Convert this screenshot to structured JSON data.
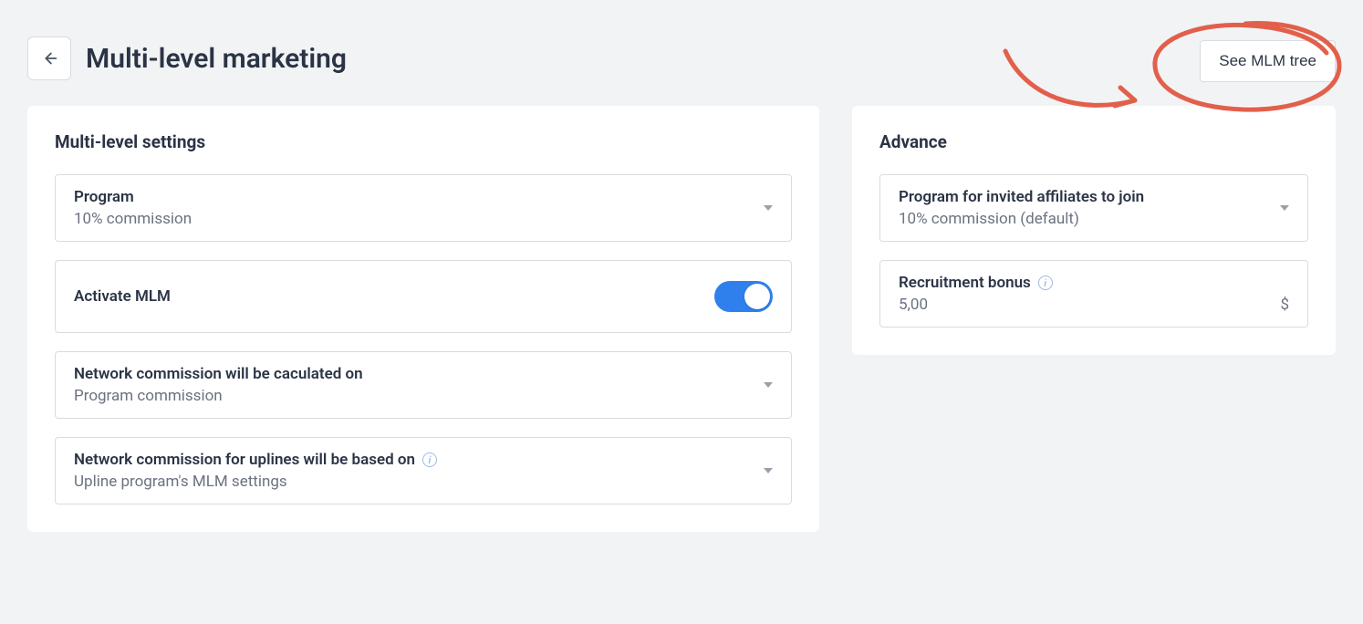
{
  "header": {
    "title": "Multi-level marketing",
    "see_tree_label": "See MLM tree"
  },
  "settings_card": {
    "title": "Multi-level settings",
    "program_label": "Program",
    "program_value": "10% commission",
    "activate_label": "Activate MLM",
    "activate_on": true,
    "network_calc_label": "Network commission will be caculated on",
    "network_calc_value": "Program commission",
    "uplines_label": "Network commission for uplines will be based on",
    "uplines_value": "Upline program's MLM settings"
  },
  "advance_card": {
    "title": "Advance",
    "invited_program_label": "Program for invited affiliates to join",
    "invited_program_value": "10% commission (default)",
    "recruitment_label": "Recruitment bonus",
    "recruitment_value": "5,00",
    "recruitment_currency": "$"
  },
  "annotation": {
    "target": "see-mlm-tree-button",
    "color": "#e2604b"
  }
}
